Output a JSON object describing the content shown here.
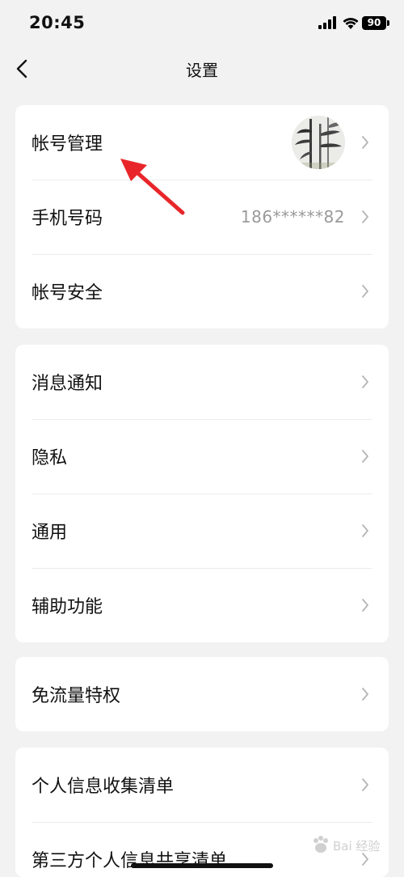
{
  "status_bar": {
    "time": "20:45",
    "battery": "90"
  },
  "nav": {
    "title": "设置"
  },
  "groups": [
    {
      "items": [
        {
          "label": "帐号管理",
          "type": "avatar"
        },
        {
          "label": "手机号码",
          "value": "186******82"
        },
        {
          "label": "帐号安全"
        }
      ]
    },
    {
      "items": [
        {
          "label": "消息通知"
        },
        {
          "label": "隐私"
        },
        {
          "label": "通用"
        },
        {
          "label": "辅助功能"
        }
      ]
    },
    {
      "items": [
        {
          "label": "免流量特权"
        }
      ]
    },
    {
      "items": [
        {
          "label": "个人信息收集清单"
        },
        {
          "label": "第三方个人信息共享清单"
        }
      ]
    }
  ],
  "watermark": {
    "text": "Bai 经验"
  },
  "colors": {
    "annotation_arrow": "#e8262a",
    "chevron": "#b5b5b5"
  }
}
